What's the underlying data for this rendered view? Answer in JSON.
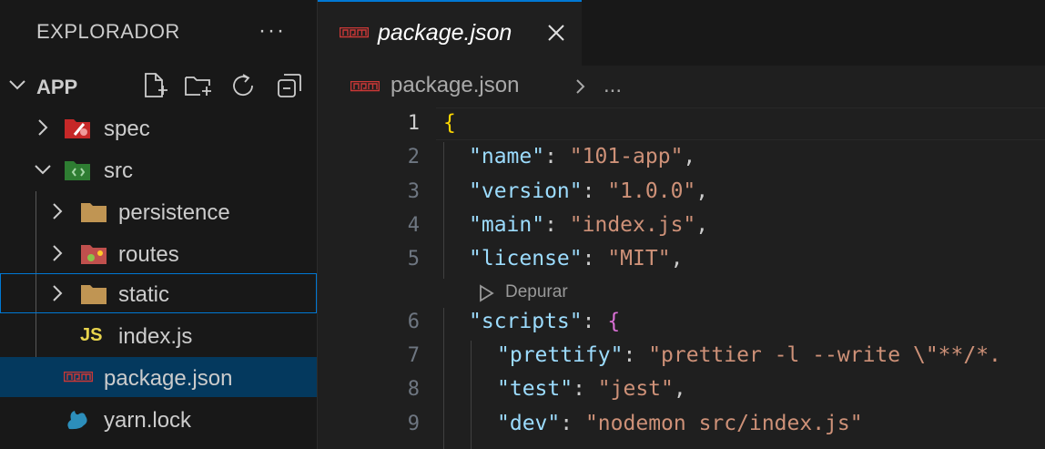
{
  "sidebar": {
    "title": "EXPLORADOR",
    "more_label": "···",
    "section": {
      "title": "APP"
    },
    "tree": [
      {
        "label": "spec"
      },
      {
        "label": "src"
      },
      {
        "label": "persistence"
      },
      {
        "label": "routes"
      },
      {
        "label": "static"
      },
      {
        "label": "index.js",
        "icon_text": "JS"
      },
      {
        "label": "package.json"
      },
      {
        "label": "yarn.lock"
      }
    ]
  },
  "editor": {
    "tab": {
      "label": "package.json",
      "icon_text": "npm"
    },
    "breadcrumb": {
      "file": "package.json",
      "more": "..."
    },
    "codelens": "Depurar",
    "line_numbers": [
      "1",
      "2",
      "3",
      "4",
      "5",
      "6",
      "7",
      "8",
      "9"
    ],
    "code": {
      "l1_open": "{",
      "name_key": "\"name\"",
      "name_val": "\"101-app\"",
      "version_key": "\"version\"",
      "version_val": "\"1.0.0\"",
      "main_key": "\"main\"",
      "main_val": "\"index.js\"",
      "license_key": "\"license\"",
      "license_val": "\"MIT\"",
      "scripts_key": "\"scripts\"",
      "scripts_open": "{",
      "prettify_key": "\"prettify\"",
      "prettify_val": "\"prettier -l --write \\\"**/*.",
      "test_key": "\"test\"",
      "test_val": "\"jest\"",
      "dev_key": "\"dev\"",
      "dev_val": "\"nodemon src/index.js\"",
      "colon": ": ",
      "comma": ","
    }
  },
  "colors": {
    "accent": "#0078d4",
    "selection": "#04395e",
    "json_key": "#9cdcfe",
    "json_string": "#ce9178"
  }
}
